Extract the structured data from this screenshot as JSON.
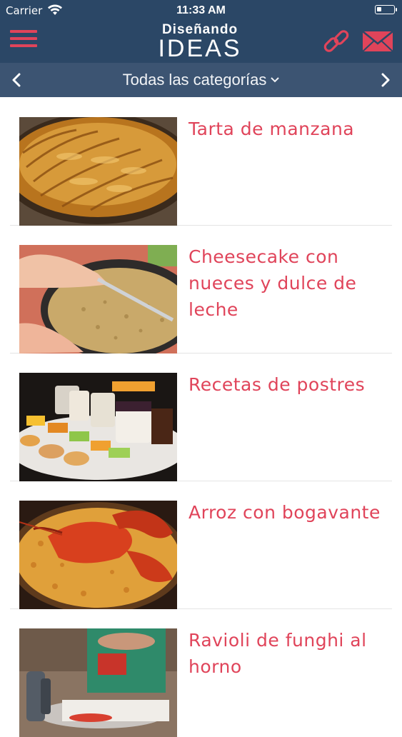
{
  "status_bar": {
    "carrier": "Carrier",
    "time": "11:33 AM"
  },
  "header": {
    "logo_line1": "Diseñando",
    "logo_line2": "IDEAS",
    "menu_icon": "hamburger-menu-icon",
    "link_icon": "link-icon",
    "mail_icon": "envelope-icon",
    "accent_color": "#e0445a",
    "background_color": "#2b4766"
  },
  "category_bar": {
    "title": "Todas las categorías",
    "background_color": "#3c5472"
  },
  "recipes": [
    {
      "title": "Tarta de manzana"
    },
    {
      "title": "Cheesecake con nueces y dulce de leche"
    },
    {
      "title": "Recetas de postres"
    },
    {
      "title": "Arroz con bogavante"
    },
    {
      "title": "Ravioli de funghi al horno"
    }
  ]
}
